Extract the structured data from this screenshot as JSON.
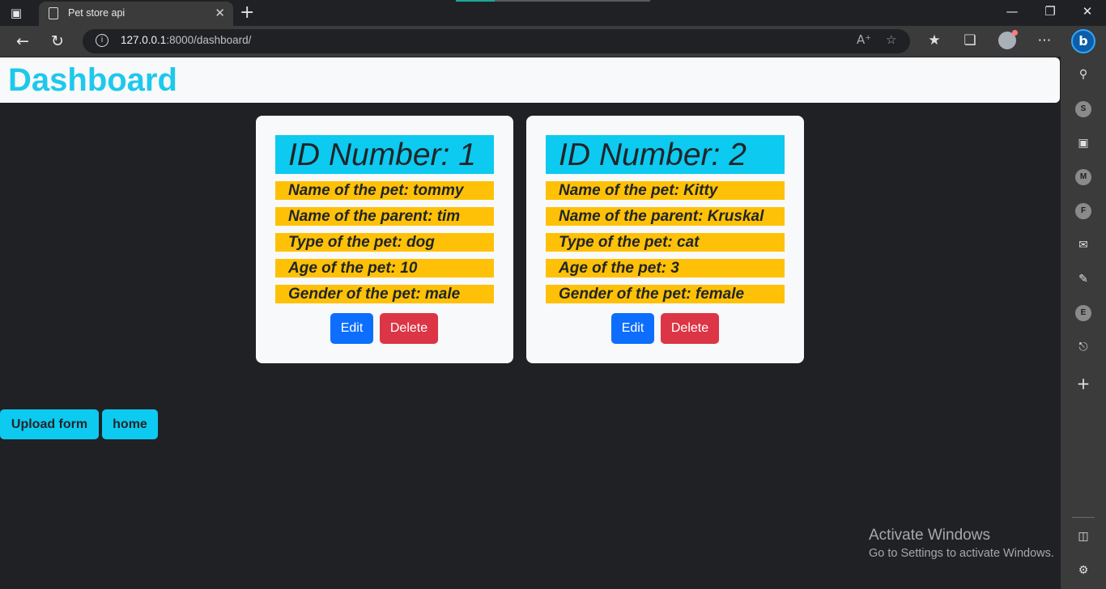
{
  "browser": {
    "tab_title": "Pet store api",
    "url_host": "127.0.0.1",
    "url_rest": ":8000/dashboard/",
    "icons": {
      "tab_actions": "tab-actions-icon",
      "favicon": "page-icon",
      "tab_close": "close-icon",
      "new_tab": "plus-icon",
      "back": "arrow-left-icon",
      "refresh": "refresh-icon",
      "info": "info-icon",
      "read_aloud": "read-aloud-icon",
      "add_favorite": "star-plus-icon",
      "favorites": "favorites-icon",
      "collections": "collections-icon",
      "profile": "profile-icon",
      "more": "more-icon",
      "bing": "bing-icon"
    },
    "window": {
      "minimize": "minimize-icon",
      "restore": "restore-icon",
      "close": "close-icon"
    }
  },
  "sidebar": {
    "letters": [
      "S",
      "M",
      "F",
      "E"
    ],
    "icons": [
      "search-icon",
      "briefcase-icon",
      "outlook-icon",
      "drawing-icon",
      "bell-icon",
      "plus-icon",
      "panel-icon",
      "gear-icon"
    ]
  },
  "page": {
    "title": "Dashboard",
    "cards": [
      {
        "id_label": "ID Number: 1",
        "name": "Name of the pet: tommy",
        "parent": "Name of the parent: tim",
        "type": "Type of the pet: dog",
        "age": "Age of the pet: 10",
        "gender": "Gender of the pet: male",
        "edit_label": "Edit",
        "delete_label": "Delete"
      },
      {
        "id_label": "ID Number: 2",
        "name": "Name of the pet: Kitty",
        "parent": "Name of the parent: Kruskal",
        "type": "Type of the pet: cat",
        "age": "Age of the pet: 3",
        "gender": "Gender of the pet: female",
        "edit_label": "Edit",
        "delete_label": "Delete"
      }
    ],
    "upload_label": "Upload form",
    "home_label": "home"
  },
  "watermark": {
    "line1": "Activate Windows",
    "line2": "Go to Settings to activate Windows."
  },
  "colors": {
    "header_title": "#1ec8ec",
    "id_bar": "#0dcaf0",
    "field_bar": "#ffc107",
    "edit": "#0d6efd",
    "delete": "#dc3545",
    "page_bg": "#202124"
  }
}
